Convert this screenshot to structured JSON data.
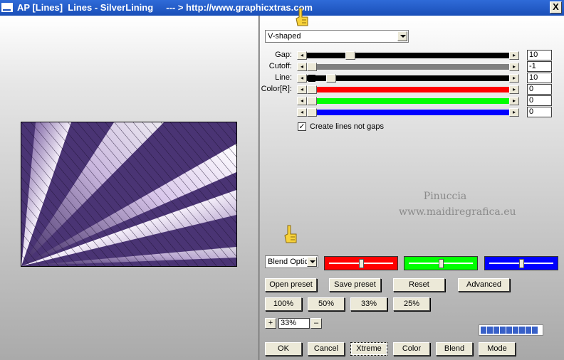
{
  "window": {
    "title": "AP [Lines]  Lines - SilverLining     --- > http://www.graphicxtras.com",
    "close_label": "X"
  },
  "preset_select": {
    "value": "V-shaped"
  },
  "sliders": [
    {
      "label": "Gap:",
      "value": "10",
      "position": 0.2,
      "track_color": "#000000"
    },
    {
      "label": "Cutoff:",
      "value": "-1",
      "position": 0.0,
      "track_color": "#808080"
    },
    {
      "label": "Line:",
      "value": "10",
      "position": 0.05,
      "track_color": "#000000",
      "marker": true
    },
    {
      "label": "Color[R]:",
      "value": "0",
      "position": 0.0,
      "track_color": "#ff0000"
    },
    {
      "label": "",
      "value": "0",
      "position": 0.0,
      "track_color": "#00ff00"
    },
    {
      "label": "",
      "value": "0",
      "position": 0.0,
      "track_color": "#0000ff"
    }
  ],
  "checkbox": {
    "label": "Create lines not gaps",
    "checked": true,
    "mark": "✓"
  },
  "watermark": {
    "line1": "Pinuccia",
    "line2": "www.maidiregrafica.eu"
  },
  "blend_select": {
    "value": "Blend Optio"
  },
  "color_sliders": [
    {
      "color": "#ff0000",
      "position": 0.5
    },
    {
      "color": "#00ff00",
      "position": 0.5
    },
    {
      "color": "#0000ff",
      "position": 0.5
    }
  ],
  "buttons": {
    "open_preset": "Open preset",
    "save_preset": "Save preset",
    "reset": "Reset",
    "advanced": "Advanced",
    "zoom_100": "100%",
    "zoom_50": "50%",
    "zoom_33": "33%",
    "zoom_25": "25%",
    "ok": "OK",
    "cancel": "Cancel",
    "xtreme": "Xtreme",
    "color": "Color",
    "blend": "Blend",
    "mode": "Mode"
  },
  "zoom": {
    "plus": "+",
    "minus": "–",
    "value": "33%"
  },
  "progress": {
    "fraction": 1.0
  }
}
